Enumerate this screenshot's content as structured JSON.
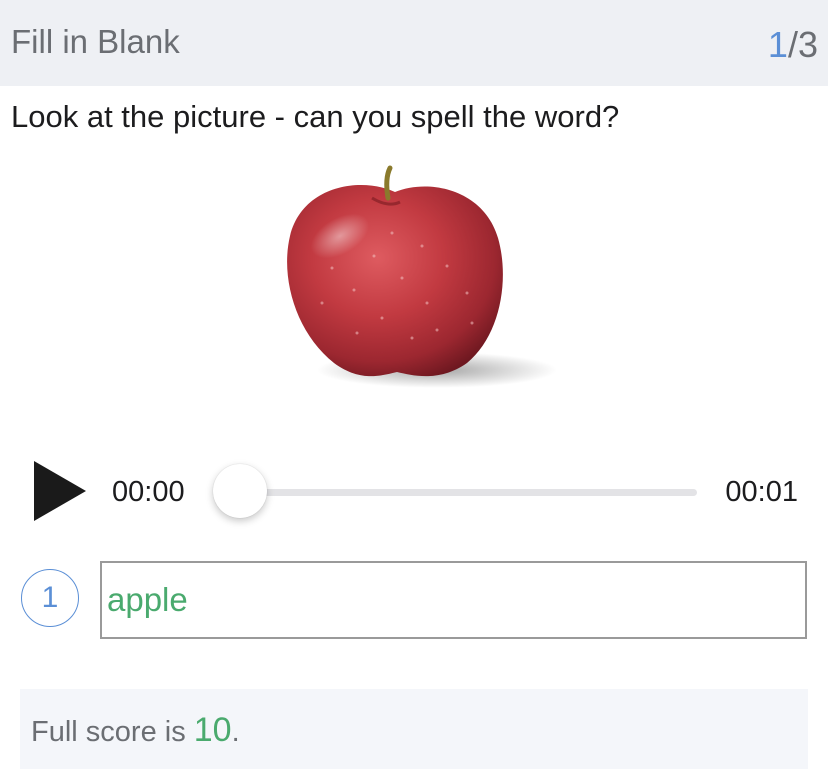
{
  "header": {
    "title": "Fill in Blank",
    "current": "1",
    "separator": "/",
    "total": "3"
  },
  "question": {
    "prompt": "Look at the picture - can you spell the word?",
    "image_subject": "apple-icon"
  },
  "player": {
    "current_time": "00:00",
    "total_time": "00:01",
    "progress": 0,
    "play_icon": "play-icon"
  },
  "answer": {
    "number": "1",
    "value": "apple"
  },
  "score": {
    "prefix": "Full score is ",
    "value": "10",
    "suffix": "."
  },
  "colors": {
    "accent_blue": "#5b8fd6",
    "correct_green": "#4aaa6e",
    "header_bg": "#eef0f4",
    "muted_text": "#6b6e73"
  }
}
